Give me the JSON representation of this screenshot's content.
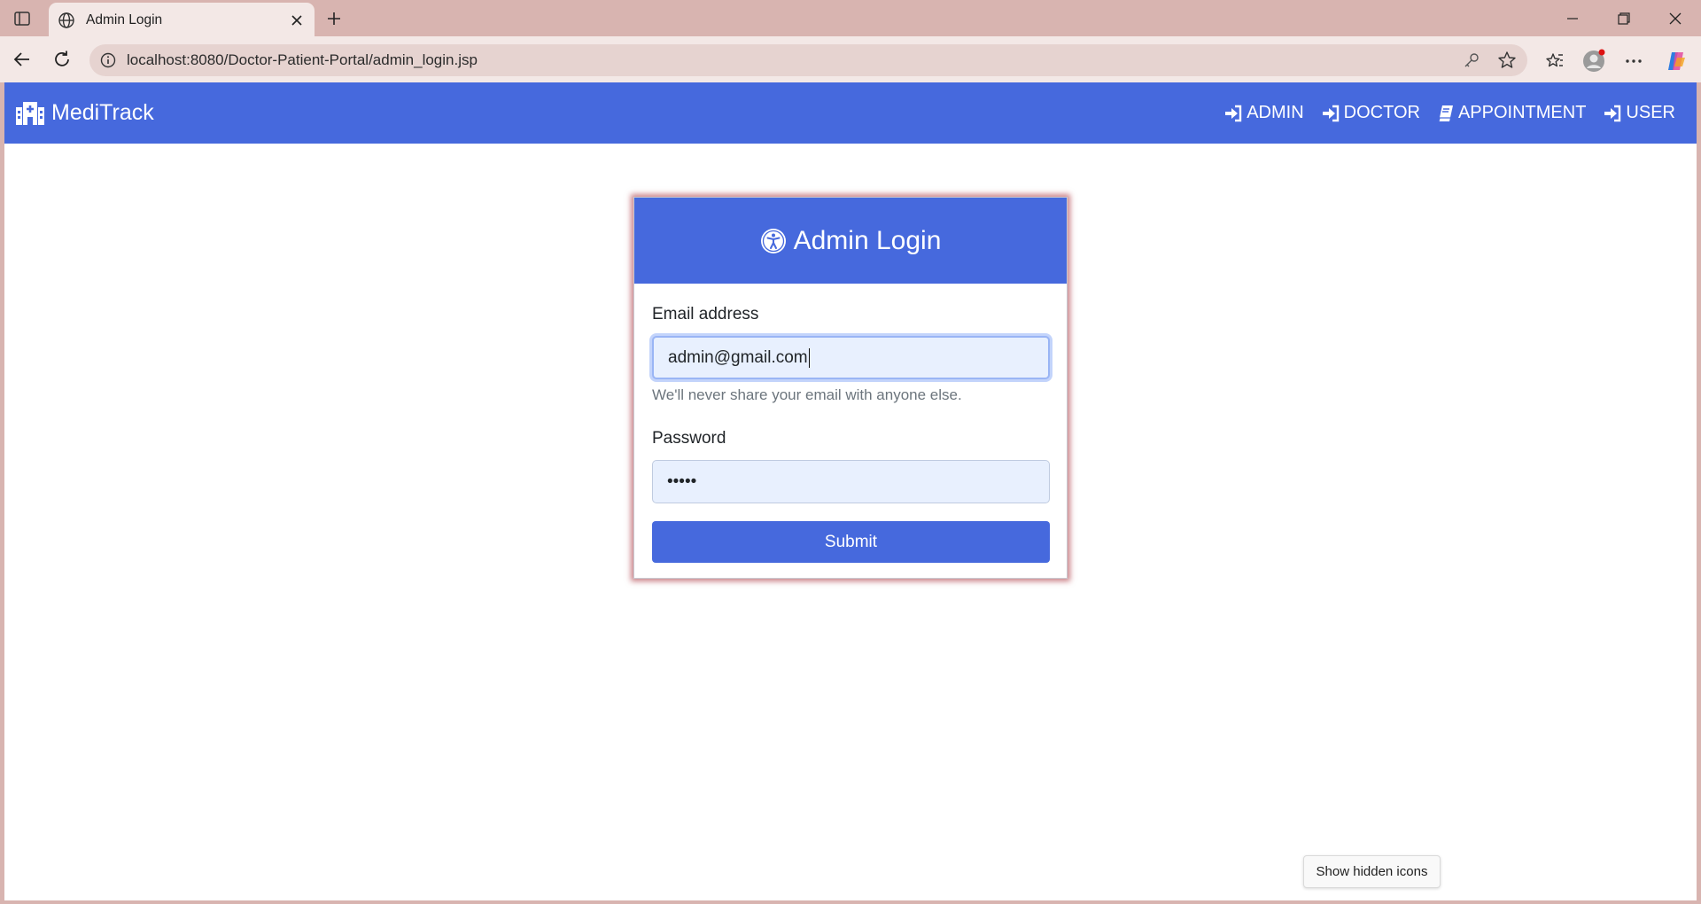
{
  "browser": {
    "tab_title": "Admin Login",
    "url": "localhost:8080/Doctor-Patient-Portal/admin_login.jsp"
  },
  "navbar": {
    "brand": "MediTrack",
    "links": [
      {
        "label": "ADMIN",
        "icon": "sign-in-icon"
      },
      {
        "label": "DOCTOR",
        "icon": "sign-in-icon"
      },
      {
        "label": "APPOINTMENT",
        "icon": "book-icon"
      },
      {
        "label": "USER",
        "icon": "sign-in-icon"
      }
    ]
  },
  "login_card": {
    "title": "Admin Login",
    "email_label": "Email address",
    "email_value": "admin@gmail.com",
    "email_help": "We'll never share your email with anyone else.",
    "password_label": "Password",
    "password_value": "•••••",
    "submit_label": "Submit"
  },
  "tooltip": "Show hidden icons",
  "colors": {
    "primary": "#4669dd",
    "browser_frame": "#d8b4b0",
    "card_glow": "#a01e28"
  }
}
